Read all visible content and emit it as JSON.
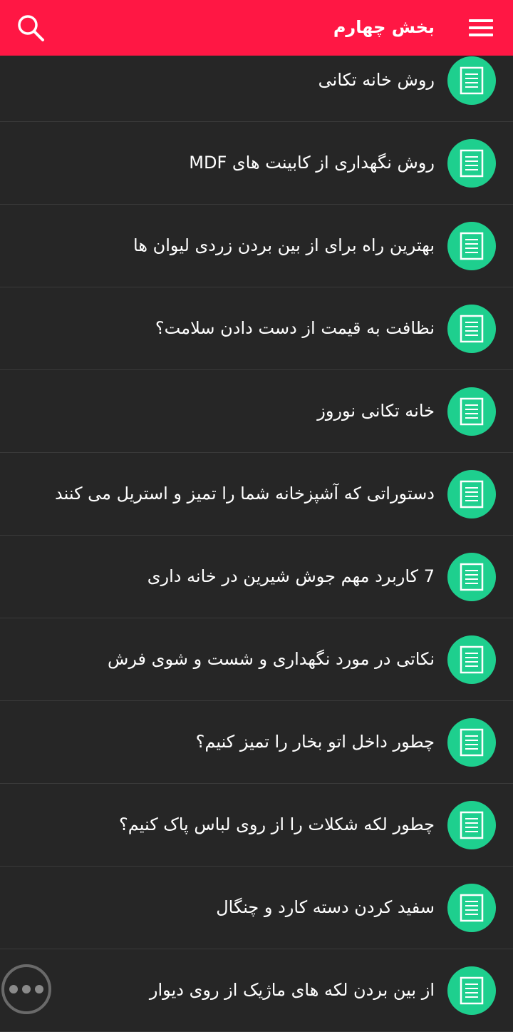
{
  "header": {
    "title": "بخش چهارم",
    "menu_icon": "hamburger-menu-icon",
    "search_icon": "search-icon",
    "background_color": "#ff1744"
  },
  "list": {
    "item_icon": "document-icon",
    "icon_color": "#1ecf8e",
    "items": [
      {
        "title": "روش خانه تکانی"
      },
      {
        "title": "روش نگهداری از کابینت های MDF"
      },
      {
        "title": "بهترین راه برای از بین بردن زردی لیوان ها"
      },
      {
        "title": "نظافت به قیمت از دست دادن سلامت؟"
      },
      {
        "title": "خانه تکانی نوروز"
      },
      {
        "title": "دستوراتی که آشپزخانه شما را تمیز و استریل می کنند"
      },
      {
        "title": "7 کاربرد مهم جوش شیرین در خانه داری"
      },
      {
        "title": "نکاتی در مورد نگهداری و شست و شوی فرش"
      },
      {
        "title": "چطور داخل اتو بخار را تمیز کنیم؟"
      },
      {
        "title": "چطور لکه شکلات را از روی لباس پاک کنیم؟"
      },
      {
        "title": "سفید کردن دسته کارد و چنگال"
      },
      {
        "title": "از بین بردن لکه های ماژیک از روی دیوار"
      }
    ]
  },
  "floating_button": {
    "icon": "more-dots-icon"
  }
}
